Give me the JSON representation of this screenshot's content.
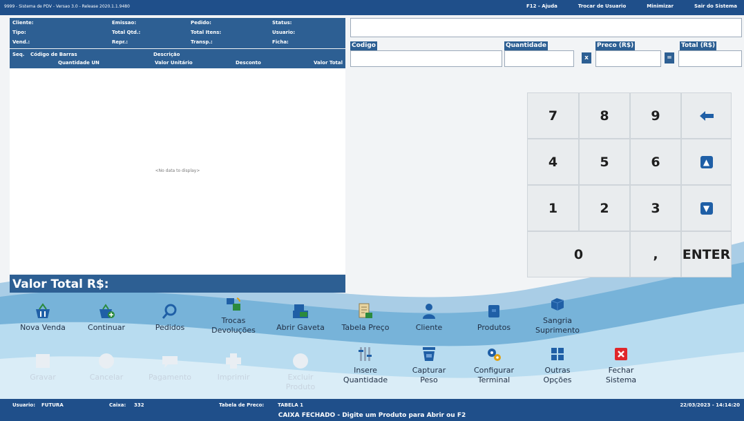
{
  "topbar": {
    "title": "9999 - Sistema de PDV - Versao 3.0 - Release 2020.1.1.9480",
    "links": [
      "F12 - Ajuda",
      "Trocar de Usuario",
      "Minimizar",
      "Sair do Sistema"
    ]
  },
  "info": {
    "cliente": "Cliente:",
    "emissao": "Emissao:",
    "pedido": "Pedido:",
    "status": "Status:",
    "tipo": "Tipo:",
    "total_qtd": "Total Qtd.:",
    "total_itens": "Total Itens:",
    "usuario": "Usuario:",
    "vend": "Vend.:",
    "repr": "Repr.:",
    "transp": "Transp.:",
    "ficha": "Ficha:"
  },
  "grid": {
    "seq": "Seq.",
    "codigo_barras": "Código de Barras",
    "descricao": "Descrição",
    "quantidade_un": "Quantidade  UN",
    "valor_unitario": "Valor Unitário",
    "desconto": "Desconto",
    "valor_total": "Valor Total",
    "empty": "<No data to display>"
  },
  "total_label": "Valor Total R$:",
  "fields": {
    "codigo": "Codigo",
    "quantidade": "Quantidade",
    "preco": "Preco (R$)",
    "total": "Total (R$)",
    "op_x": "x",
    "op_eq": "="
  },
  "keypad": {
    "k7": "7",
    "k8": "8",
    "k9": "9",
    "k4": "4",
    "k5": "5",
    "k6": "6",
    "k1": "1",
    "k2": "2",
    "k3": "3",
    "k0": "0",
    "comma": ",",
    "enter": "ENTER"
  },
  "toolbar_row1": [
    {
      "label": "Nova Venda",
      "icon": "basket-icon"
    },
    {
      "label": "Continuar",
      "icon": "basket-plus-icon"
    },
    {
      "label": "Pedidos",
      "icon": "search-icon"
    },
    {
      "label1": "Trocas",
      "label2": "Devoluções",
      "icon": "exchange-icon"
    },
    {
      "label": "Abrir Gaveta",
      "icon": "cash-drawer-icon"
    },
    {
      "label": "Tabela Preço",
      "icon": "price-table-icon"
    },
    {
      "label": "Cliente",
      "icon": "person-icon"
    },
    {
      "label": "Produtos",
      "icon": "box-icon"
    },
    {
      "label1": "Sangria",
      "label2": "Suprimento",
      "icon": "cube-icon"
    }
  ],
  "toolbar_row2": [
    {
      "label": "Gravar",
      "icon": "save-icon"
    },
    {
      "label": "Cancelar",
      "icon": "cancel-icon"
    },
    {
      "label": "Pagamento",
      "icon": "payment-icon"
    },
    {
      "label": "Imprimir",
      "icon": "print-icon"
    },
    {
      "label1": "Excluir",
      "label2": "Produto",
      "icon": "delete-icon"
    },
    {
      "label1": "Insere",
      "label2": "Quantidade",
      "icon": "sliders-icon"
    },
    {
      "label1": "Capturar",
      "label2": "Peso",
      "icon": "scale-icon"
    },
    {
      "label1": "Configurar",
      "label2": "Terminal",
      "icon": "gears-icon"
    },
    {
      "label1": "Outras",
      "label2": "Opções",
      "icon": "grid-icon"
    },
    {
      "label1": "Fechar",
      "label2": "Sistema",
      "icon": "close-icon"
    }
  ],
  "status": {
    "usuario_label": "Usuario:",
    "usuario": "FUTURA",
    "caixa_label": "Caixa:",
    "caixa": "332",
    "tabela_label": "Tabela de Preco:",
    "tabela": "TABELA 1",
    "datetime": "22/03/2023 - 14:14:20",
    "message": "CAIXA FECHADO - Digite um Produto para Abrir ou F2"
  },
  "colors": {
    "primary": "#2d5f93",
    "bar": "#1f4f8a",
    "accent": "#1f5fa6",
    "close": "#e0262a"
  }
}
